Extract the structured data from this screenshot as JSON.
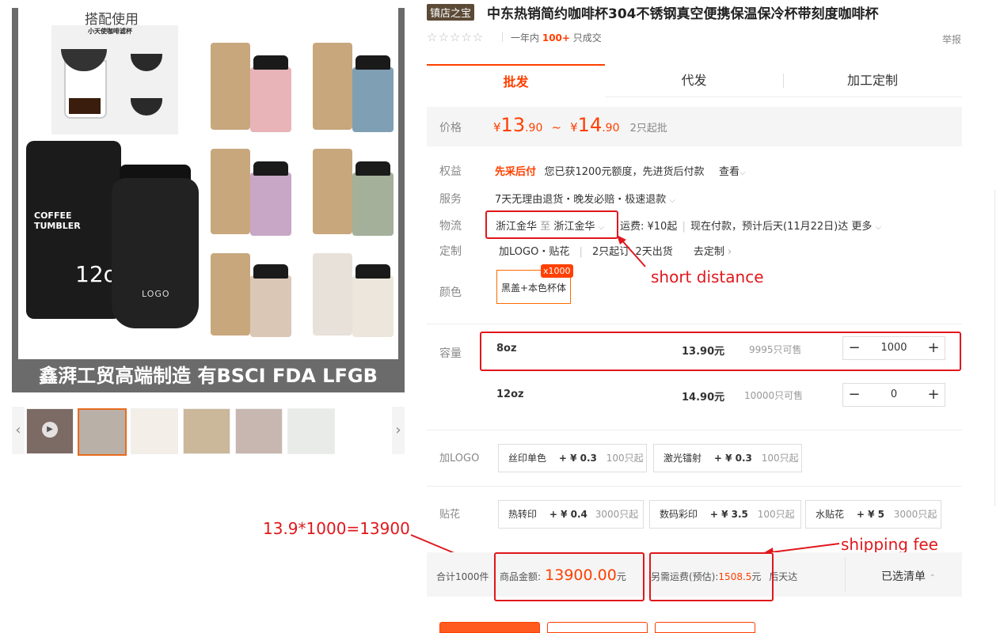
{
  "gallery": {
    "label_top": "搭配使用",
    "filter_title": "小天使咖啡滤杯",
    "banner": "鑫湃工贸高端制造   有BSCI FDA LFGB",
    "tube_text": "COFFEE\nTUMBLER",
    "oz_text": "12oz",
    "logo_text": "LOGO",
    "thumbnail_count": 7
  },
  "product": {
    "badge": "镇店之宝",
    "title": "中东热销简约咖啡杯304不锈钢真空便携保温保冷杯带刻度咖啡杯",
    "stars": "☆☆☆☆☆",
    "sales_prefix": "一年内",
    "sales_count": "100+",
    "sales_suffix": "只成交",
    "report": "举报"
  },
  "tabs": [
    "批发",
    "代发",
    "加工定制"
  ],
  "price": {
    "label": "价格",
    "currency": "¥",
    "low_int": "13",
    "low_dec": ".90",
    "sep": "~",
    "high_int": "14",
    "high_dec": ".90",
    "moq": "2只起批"
  },
  "rights": {
    "label": "权益",
    "highlight": "先采后付",
    "text": "您已获1200元额度，先进货后付款",
    "link": "查看"
  },
  "service": {
    "label": "服务",
    "text": "7天无理由退货・晚发必赔・极速退款"
  },
  "logistics": {
    "label": "物流",
    "from": "浙江金华",
    "to_word": "至",
    "to": "浙江金华",
    "fee": "运费: ¥10起",
    "eta": "现在付款，预计后天(11月22日)达",
    "more": "更多"
  },
  "custom": {
    "label": "定制",
    "option": "加LOGO・贴花",
    "moq": "2只起订",
    "days": "2天出货",
    "link": "去定制"
  },
  "color": {
    "label": "颜色",
    "option": "黑盖+本色杯体",
    "count_badge": "x1000"
  },
  "capacity": {
    "label": "容量",
    "rows": [
      {
        "name": "8oz",
        "price": "13.90元",
        "stock": "9995只可售",
        "qty": "1000"
      },
      {
        "name": "12oz",
        "price": "14.90元",
        "stock": "10000只可售",
        "qty": "0"
      }
    ]
  },
  "add_logo": {
    "label": "加LOGO",
    "options": [
      {
        "name": "丝印单色",
        "price": "+ ¥ 0.3",
        "moq": "100只起"
      },
      {
        "name": "激光镭射",
        "price": "+ ¥ 0.3",
        "moq": "100只起"
      }
    ]
  },
  "decal": {
    "label": "贴花",
    "options": [
      {
        "name": "热转印",
        "price": "+ ¥ 0.4",
        "moq": "3000只起"
      },
      {
        "name": "数码彩印",
        "price": "+ ¥ 3.5",
        "moq": "100只起"
      },
      {
        "name": "水贴花",
        "price": "+ ¥ 5",
        "moq": "3000只起"
      }
    ]
  },
  "footer": {
    "total_count": "合计1000件",
    "goods_label": "商品金额:",
    "goods_amount": "13900.00",
    "goods_unit": "元",
    "ship_label": "另需运费(预估):",
    "ship_amount": "1508.5",
    "ship_unit": "元",
    "arrive": "后天达",
    "cart": "已选清单"
  },
  "annotations": {
    "short_distance": "short distance",
    "calc": "13.9*1000=13900",
    "shipping_fee": "shipping fee"
  },
  "colors": {
    "accent": "#ff4000",
    "annotation_red": "#e0171c",
    "badge_brown": "#5b4a36"
  }
}
